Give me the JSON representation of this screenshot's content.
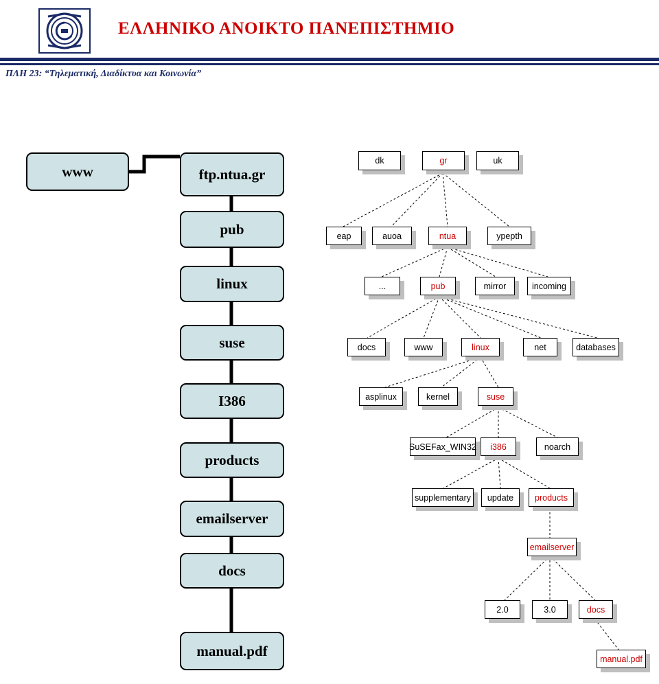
{
  "header": {
    "university": "ΕΛΛΗΝΙΚΟ ΑΝΟΙΚΤΟ ΠΑΝΕΠΙΣΤΗΜΙΟ",
    "course": "ΠΛΗ 23: “Τηλεματική, Διαδίκτυα και Κοινωνία”",
    "logo_icon": "eap-logo-icon",
    "accent_color": "#cc0000",
    "rule_color": "#1a2a66"
  },
  "path_boxes": [
    {
      "label": "www"
    },
    {
      "label": "ftp.ntua.gr"
    },
    {
      "label": "pub"
    },
    {
      "label": "linux"
    },
    {
      "label": "suse"
    },
    {
      "label": "I386"
    },
    {
      "label": "products"
    },
    {
      "label": "emailserver"
    },
    {
      "label": "docs"
    },
    {
      "label": "manual.pdf"
    }
  ],
  "tree": {
    "levels": [
      {
        "nodes": [
          {
            "label": "dk",
            "highlight": false
          },
          {
            "label": "gr",
            "highlight": true
          },
          {
            "label": "uk",
            "highlight": false
          }
        ]
      },
      {
        "nodes": [
          {
            "label": "eap",
            "highlight": false
          },
          {
            "label": "auoa",
            "highlight": false
          },
          {
            "label": "ntua",
            "highlight": true
          },
          {
            "label": "ypepth",
            "highlight": false
          }
        ]
      },
      {
        "nodes": [
          {
            "label": "...",
            "highlight": false
          },
          {
            "label": "pub",
            "highlight": true
          },
          {
            "label": "mirror",
            "highlight": false
          },
          {
            "label": "incoming",
            "highlight": false
          }
        ]
      },
      {
        "nodes": [
          {
            "label": "docs",
            "highlight": false
          },
          {
            "label": "www",
            "highlight": false
          },
          {
            "label": "linux",
            "highlight": true
          },
          {
            "label": "net",
            "highlight": false
          },
          {
            "label": "databases",
            "highlight": false
          }
        ]
      },
      {
        "nodes": [
          {
            "label": "asplinux",
            "highlight": false
          },
          {
            "label": "kernel",
            "highlight": false
          },
          {
            "label": "suse",
            "highlight": true
          }
        ]
      },
      {
        "nodes": [
          {
            "label": "SuSEFax_WIN32",
            "highlight": false
          },
          {
            "label": "i386",
            "highlight": true
          },
          {
            "label": "noarch",
            "highlight": false
          }
        ]
      },
      {
        "nodes": [
          {
            "label": "supplementary",
            "highlight": false
          },
          {
            "label": "update",
            "highlight": false
          },
          {
            "label": "products",
            "highlight": true
          }
        ]
      },
      {
        "nodes": [
          {
            "label": "emailserver",
            "highlight": true
          }
        ]
      },
      {
        "nodes": [
          {
            "label": "2.0",
            "highlight": false
          },
          {
            "label": "3.0",
            "highlight": false
          },
          {
            "label": "docs",
            "highlight": true
          }
        ]
      },
      {
        "nodes": [
          {
            "label": "manual.pdf",
            "highlight": true
          }
        ]
      }
    ]
  },
  "colors": {
    "box_fill": "#cfe3e6",
    "node_fill": "#ffffff",
    "shadow": "#bfbfbf",
    "highlight_text": "#cc0000"
  }
}
